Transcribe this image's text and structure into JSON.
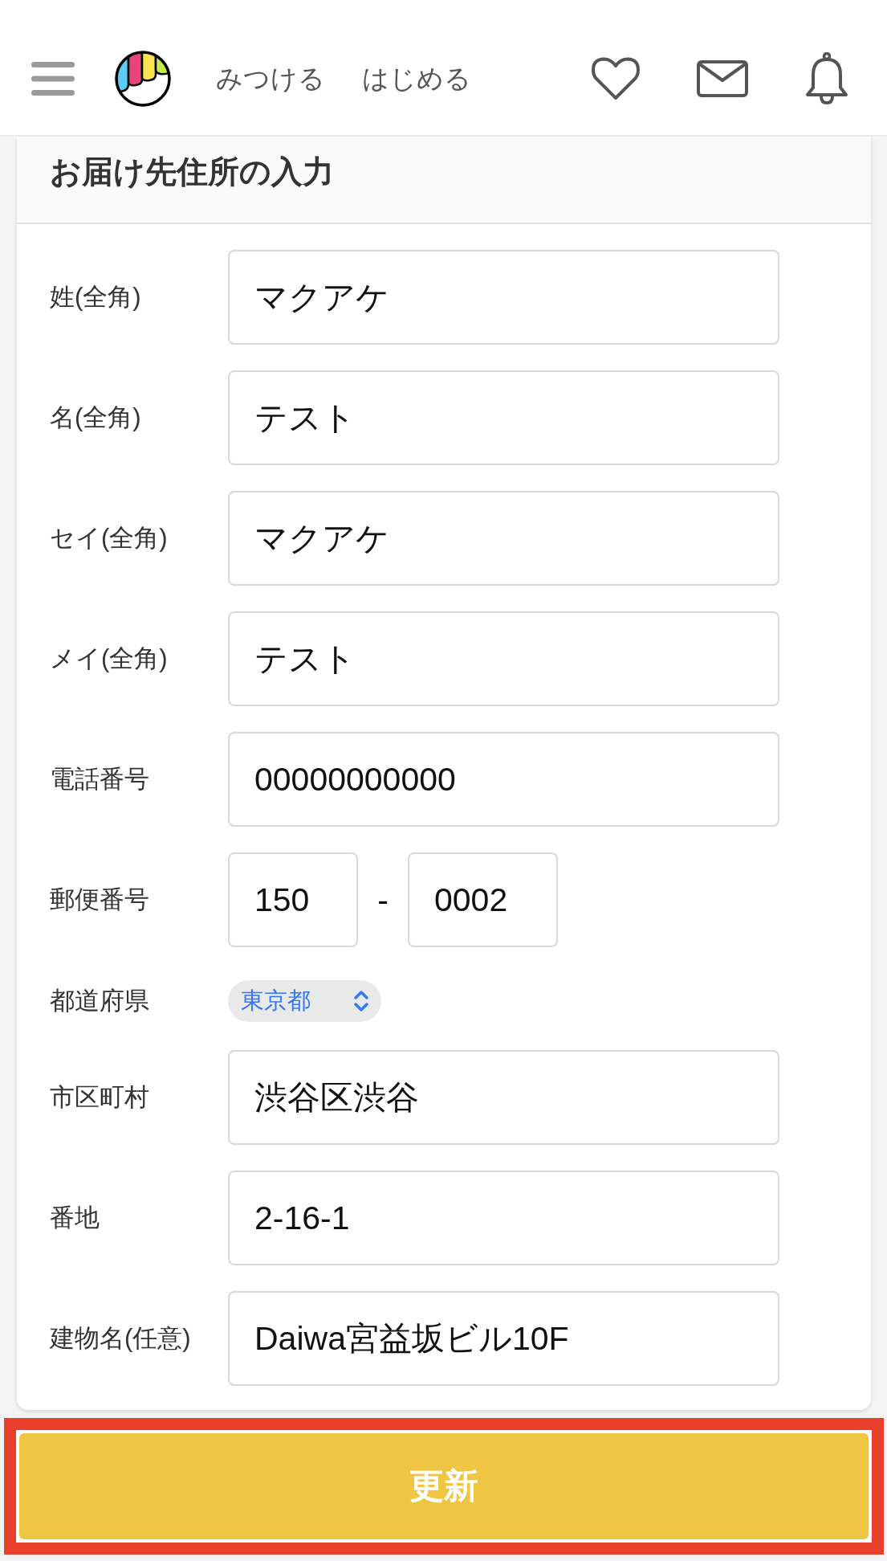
{
  "header": {
    "nav_links": [
      {
        "label": "みつける"
      },
      {
        "label": "はじめる"
      }
    ]
  },
  "form": {
    "title": "お届け先住所の入力",
    "fields": [
      {
        "kind": "text",
        "label": "姓(全角)",
        "value": "マクアケ"
      },
      {
        "kind": "text",
        "label": "名(全角)",
        "value": "テスト"
      },
      {
        "kind": "text",
        "label": "セイ(全角)",
        "value": "マクアケ"
      },
      {
        "kind": "text",
        "label": "メイ(全角)",
        "value": "テスト"
      },
      {
        "kind": "text",
        "label": "電話番号",
        "value": "00000000000"
      },
      {
        "kind": "postal",
        "label": "郵便番号",
        "values": [
          "150",
          "0002"
        ],
        "separator": "-"
      },
      {
        "kind": "select",
        "label": "都道府県",
        "value": "東京都"
      },
      {
        "kind": "text",
        "label": "市区町村",
        "value": "渋谷区渋谷"
      },
      {
        "kind": "text",
        "label": "番地",
        "value": "2-16-1"
      },
      {
        "kind": "text",
        "label": "建物名(任意)",
        "value": "Daiwa宮益坂ビル10F"
      }
    ]
  },
  "submit_button": {
    "label": "更新",
    "highlighted": true
  }
}
